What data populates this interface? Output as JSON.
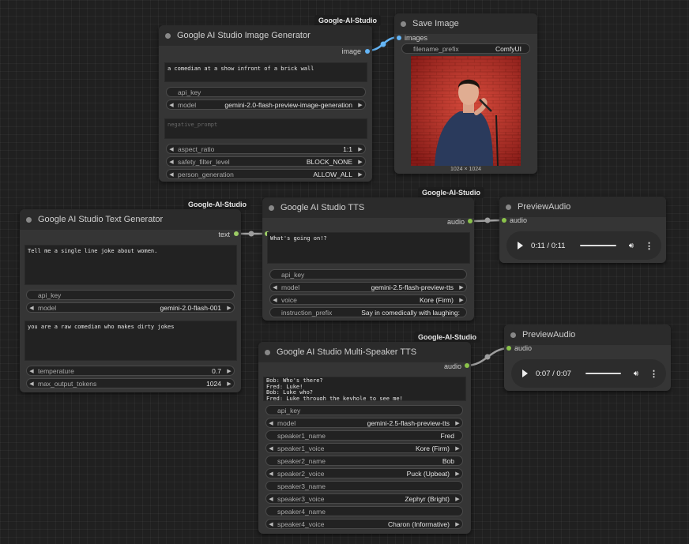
{
  "badges": {
    "group": "Google-AI-Studio"
  },
  "image_gen": {
    "title": "Google AI Studio Image Generator",
    "output": "image",
    "prompt": "a comedian at a show infront of a brick wall",
    "api_key": "api_key",
    "model_label": "model",
    "model_value": "gemini-2.0-flash-preview-image-generation",
    "negative_prompt_placeholder": "negative_prompt",
    "aspect_label": "aspect_ratio",
    "aspect_value": "1:1",
    "safety_label": "safety_filter_level",
    "safety_value": "BLOCK_NONE",
    "person_label": "person_generation",
    "person_value": "ALLOW_ALL"
  },
  "save_image": {
    "title": "Save Image",
    "input": "images",
    "prefix_label": "filename_prefix",
    "prefix_value": "ComfyUI",
    "image_size": "1024 × 1024"
  },
  "text_gen": {
    "title": "Google AI Studio Text Generator",
    "output": "text",
    "prompt": "Tell me a single line joke about women.",
    "api_key": "api_key",
    "model_label": "model",
    "model_value": "gemini-2.0-flash-001",
    "system": "you are a raw comedian who makes dirty jokes",
    "temp_label": "temperature",
    "temp_value": "0.7",
    "tokens_label": "max_output_tokens",
    "tokens_value": "1024"
  },
  "tts": {
    "title": "Google AI Studio TTS",
    "output": "audio",
    "text": "What's going on!?",
    "api_key": "api_key",
    "model_label": "model",
    "model_value": "gemini-2.5-flash-preview-tts",
    "voice_label": "voice",
    "voice_value": "Kore (Firm)",
    "instr_label": "instruction_prefix",
    "instr_value": "Say in comedically with laughing:"
  },
  "preview1": {
    "title": "PreviewAudio",
    "input": "audio",
    "time": "0:11 / 0:11"
  },
  "preview2": {
    "title": "PreviewAudio",
    "input": "audio",
    "time": "0:07 / 0:07"
  },
  "multi": {
    "title": "Google AI Studio Multi-Speaker TTS",
    "output": "audio",
    "text": "Bob: Who's there?\nFred: Luke!\nBob: Luke who?\nFred: Luke through the keyhole to see me!",
    "api_key": "api_key",
    "model_label": "model",
    "model_value": "gemini-2.5-flash-preview-tts",
    "s1n_label": "speaker1_name",
    "s1n_value": "Fred",
    "s1v_label": "speaker1_voice",
    "s1v_value": "Kore (Firm)",
    "s2n_label": "speaker2_name",
    "s2n_value": "Bob",
    "s2v_label": "speaker2_voice",
    "s2v_value": "Puck (Upbeat)",
    "s3n_label": "speaker3_name",
    "s3v_label": "speaker3_voice",
    "s3v_value": "Zephyr (Bright)",
    "s4n_label": "speaker4_name",
    "s4v_label": "speaker4_voice",
    "s4v_value": "Charon (Informative)"
  },
  "colors": {
    "image_link": "#64b5f6",
    "audio_link": "#8bc34a",
    "text_link": "#9e9e9e"
  }
}
